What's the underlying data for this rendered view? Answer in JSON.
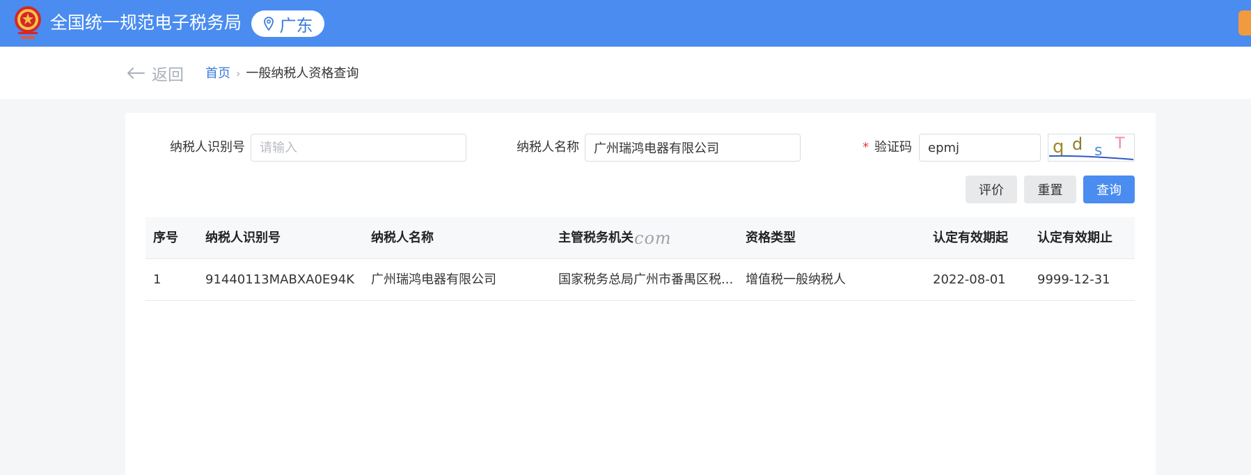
{
  "header": {
    "site_title": "全国统一规范电子税务局",
    "region": "广东"
  },
  "nav": {
    "back_label": "返回",
    "breadcrumb_home": "首页",
    "breadcrumb_separator": "›",
    "breadcrumb_current": "一般纳税人资格查询"
  },
  "form": {
    "taxpayer_id_label": "纳税人识别号",
    "taxpayer_id_placeholder": "请输入",
    "taxpayer_id_value": "",
    "taxpayer_name_label": "纳税人名称",
    "taxpayer_name_value": "广州瑞鸿电器有限公司",
    "captcha_required_mark": "*",
    "captcha_label": "验证码",
    "captcha_value": "epmj",
    "captcha_image_text": "qdsT"
  },
  "buttons": {
    "rate": "评价",
    "reset": "重置",
    "query": "查询"
  },
  "table": {
    "columns": [
      "序号",
      "纳税人识别号",
      "纳税人名称",
      "主管税务机关",
      "资格类型",
      "认定有效期起",
      "认定有效期止"
    ],
    "watermark": "com",
    "rows": [
      [
        "1",
        "91440113MABXA0E94K",
        "广州瑞鸿电器有限公司",
        "国家税务总局广州市番禺区税...",
        "增值税一般纳税人",
        "2022-08-01",
        "9999-12-31"
      ]
    ]
  },
  "colors": {
    "header_bg": "#4a8cf0",
    "accent_blue": "#3a7cdc",
    "required_red": "#e4393c",
    "orange_tab": "#f19a3e"
  }
}
